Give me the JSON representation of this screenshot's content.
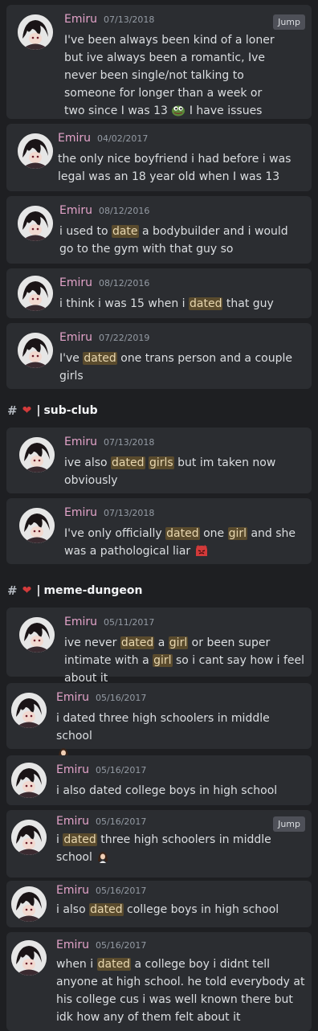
{
  "jump_label": "Jump",
  "channel_headers": [
    {
      "hash": "#",
      "heart": "❤",
      "bar": "|",
      "name": "sub-club"
    },
    {
      "hash": "#",
      "heart": "❤",
      "bar": "|",
      "name": "meme-dungeon"
    }
  ],
  "messages": [
    {
      "user": "Emiru",
      "date": "07/13/2018",
      "text": [
        "I've been always been kind of a loner but ive always been a romantic, Ive never been single/not talking to someone for longer than a week or two since I was 13 ",
        " I have issues"
      ]
    },
    {
      "user": "Emiru",
      "date": "04/02/2017",
      "text": [
        "the only nice boyfriend i had before i was legal was an 18 year old when I was 13"
      ]
    },
    {
      "user": "Emiru",
      "date": "08/12/2016",
      "text": [
        "i used to ",
        "date",
        " a bodybuilder and i would go to the gym with that guy so"
      ]
    },
    {
      "user": "Emiru",
      "date": "08/12/2016",
      "text": [
        "i think i was 15 when i ",
        "dated",
        " that guy"
      ]
    },
    {
      "user": "Emiru",
      "date": "07/22/2019",
      "text": [
        "I've ",
        "dated",
        " one trans person and a couple girls"
      ]
    },
    {
      "user": "Emiru",
      "date": "07/13/2018",
      "text": [
        "ive also ",
        "dated",
        " ",
        "girls",
        " but im taken now obviously"
      ]
    },
    {
      "user": "Emiru",
      "date": "07/13/2018",
      "text": [
        "I've only officially ",
        "dated",
        " one ",
        "girl",
        " and she was a pathological liar "
      ]
    },
    {
      "user": "Emiru",
      "date": "05/11/2017",
      "text": [
        "ive never ",
        "dated",
        " a ",
        "girl",
        " or been super intimate with a ",
        "girl",
        " so i cant say how i feel about it"
      ]
    },
    {
      "user": "Emiru",
      "date": "05/16/2017",
      "text": [
        "i dated three high schoolers in middle school"
      ]
    },
    {
      "user": "Emiru",
      "date": "05/16/2017",
      "text": [
        "i also dated college boys in high school"
      ]
    },
    {
      "user": "Emiru",
      "date": "05/16/2017",
      "text": [
        "i ",
        "dated",
        " three high schoolers in middle school "
      ]
    },
    {
      "user": "Emiru",
      "date": "05/16/2017",
      "text": [
        "i also ",
        "dated",
        " college boys in high school"
      ]
    },
    {
      "user": "Emiru",
      "date": "05/16/2017",
      "text": [
        "when i ",
        "dated",
        " a college boy i didnt tell anyone at high school. he told everybody at his college cus i was well known there but idk how any of them felt about it"
      ]
    }
  ],
  "colors": {
    "background": "#1e1f22",
    "card": "#2b2d31",
    "username": "#e3a3c9",
    "timestamp": "#949ba4",
    "highlight": "#5a4b2d"
  },
  "icons": [
    "avatar",
    "pepe-emoji",
    "angry-emoji",
    "girl-emoji",
    "heart-icon",
    "hash-icon"
  ]
}
